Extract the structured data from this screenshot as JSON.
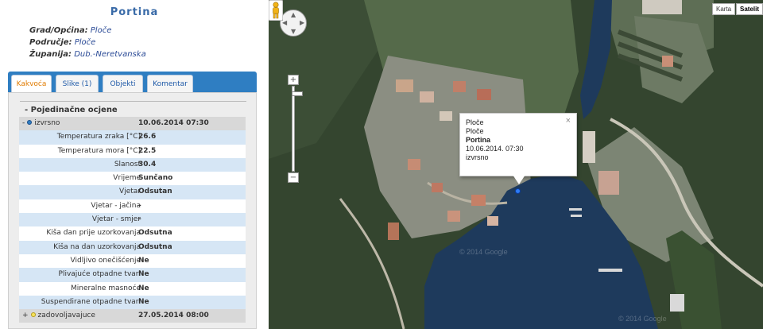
{
  "station": {
    "title": "Portina",
    "meta": [
      {
        "label": "Grad/Općina:",
        "value": "Ploče"
      },
      {
        "label": "Područje:",
        "value": "Ploče"
      },
      {
        "label": "Županija:",
        "value": "Dub.-Neretvanska"
      }
    ]
  },
  "tabs": [
    {
      "label": "Kakvoća",
      "active": true
    },
    {
      "label": "Slike (1)",
      "active": false
    },
    {
      "label": "Objekti",
      "active": false
    },
    {
      "label": "Komentar",
      "active": false
    }
  ],
  "panel": {
    "section_title": "- Pojedinačne ocjene",
    "current_sample": {
      "toggle": "-",
      "status": "izvrsno",
      "date": "10.06.2014 07:30",
      "dot_color": "#2f7ec2"
    },
    "measurements": [
      {
        "label": "Temperatura zraka [°C]",
        "value": "26.6"
      },
      {
        "label": "Temperatura mora [°C]",
        "value": "22.5"
      },
      {
        "label": "Slanost",
        "value": "30.4"
      },
      {
        "label": "Vrijeme",
        "value": "Sunčano"
      },
      {
        "label": "Vjetar",
        "value": "Odsutan"
      },
      {
        "label": "Vjetar - jačina",
        "value": "-"
      },
      {
        "label": "Vjetar - smjer",
        "value": "-"
      },
      {
        "label": "Kiša dan prije uzorkovanja",
        "value": "Odsutna"
      },
      {
        "label": "Kiša na dan uzorkovanja",
        "value": "Odsutna"
      },
      {
        "label": "Vidljivo onečišćenje",
        "value": "Ne"
      },
      {
        "label": "Plivajuće otpadne tvari",
        "value": "Ne"
      },
      {
        "label": "Mineralne masnoće",
        "value": "Ne"
      },
      {
        "label": "Suspendirane otpadne tvari",
        "value": "Ne"
      }
    ],
    "previous_sample": {
      "toggle": "+",
      "status": "zadovoljavajuce",
      "date": "27.05.2014 08:00",
      "dot_color": "#f7e35a"
    }
  },
  "map": {
    "type_buttons": [
      {
        "label": "Karta",
        "active": false
      },
      {
        "label": "Satelit",
        "active": true
      }
    ],
    "zoom_in": "+",
    "zoom_out": "−",
    "pan_icons": [
      "chevron-up-icon",
      "chevron-down-icon",
      "chevron-left-icon",
      "chevron-right-icon"
    ],
    "pegman_icon": "pegman-icon",
    "infowindow": {
      "lines": [
        "Ploče",
        "Ploče",
        "Portina",
        "10.06.2014. 07:30",
        "izvrsno"
      ],
      "close": "×"
    },
    "watermarks": [
      "© 2014 Google",
      "© 2014 Google"
    ],
    "colors": {
      "water": "#1e3a5c",
      "vegetation": "#2e4a2a",
      "rock": "#8a8c7e",
      "marker": "#2e7cf6"
    }
  }
}
